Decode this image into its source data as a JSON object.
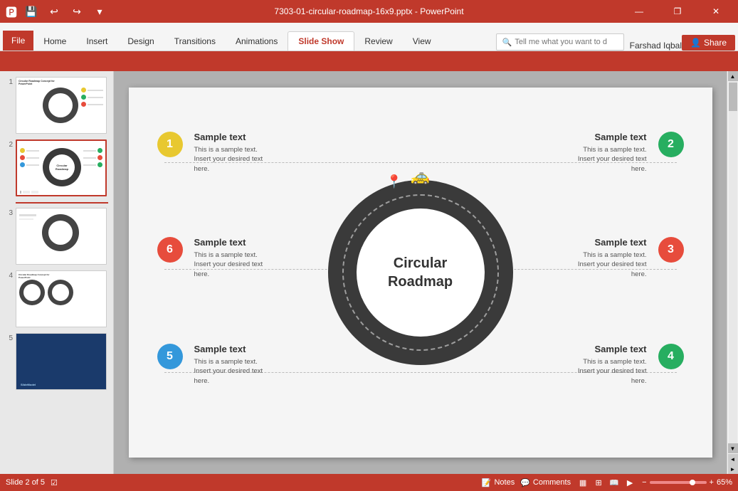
{
  "titlebar": {
    "filename": "7303-01-circular-roadmap-16x9.pptx - PowerPoint",
    "minimize": "—",
    "restore": "❐",
    "close": "✕"
  },
  "quickaccess": {
    "save": "💾",
    "undo": "↩",
    "redo": "↪",
    "customize": "▾"
  },
  "menu": {
    "items": [
      "File",
      "Home",
      "Insert",
      "Design",
      "Transitions",
      "Animations",
      "Slide Show",
      "Review",
      "View"
    ]
  },
  "search": {
    "placeholder": "Tell me what you want to do..."
  },
  "user": {
    "name": "Farshad Iqbal",
    "share": "Share"
  },
  "slides": [
    {
      "num": "1",
      "active": false
    },
    {
      "num": "2",
      "active": true
    },
    {
      "num": "3",
      "active": false
    },
    {
      "num": "4",
      "active": false
    },
    {
      "num": "5",
      "active": false
    }
  ],
  "slide": {
    "sections": [
      {
        "id": "1",
        "color": "#e8c830",
        "title": "Sample text",
        "body": "This is a sample text.\nInsert your desired text\nhere.",
        "position": "top-left"
      },
      {
        "id": "2",
        "color": "#27ae60",
        "title": "Sample text",
        "body": "This is a sample text.\nInsert your desired text\nhere.",
        "position": "top-right"
      },
      {
        "id": "3",
        "color": "#e74c3c",
        "title": "Sample text",
        "body": "This is a sample text.\nInsert your desired text\nhere.",
        "position": "mid-right"
      },
      {
        "id": "4",
        "color": "#27ae60",
        "title": "Sample text",
        "body": "This is a sample text.\nInsert your desired text\nhere.",
        "position": "bot-right"
      },
      {
        "id": "5",
        "color": "#3498db",
        "title": "Sample text",
        "body": "This is a sample text.\nInsert your desired text\nhere.",
        "position": "bot-left"
      },
      {
        "id": "6",
        "color": "#e74c3c",
        "title": "Sample text",
        "body": "This is a sample text.\nInsert your desired text\nhere.",
        "position": "mid-left"
      }
    ],
    "center": {
      "line1": "Circular",
      "line2": "Roadmap"
    }
  },
  "statusbar": {
    "slide_info": "Slide 2 of 5",
    "notes": "Notes",
    "comments": "Comments",
    "zoom": "65%"
  }
}
